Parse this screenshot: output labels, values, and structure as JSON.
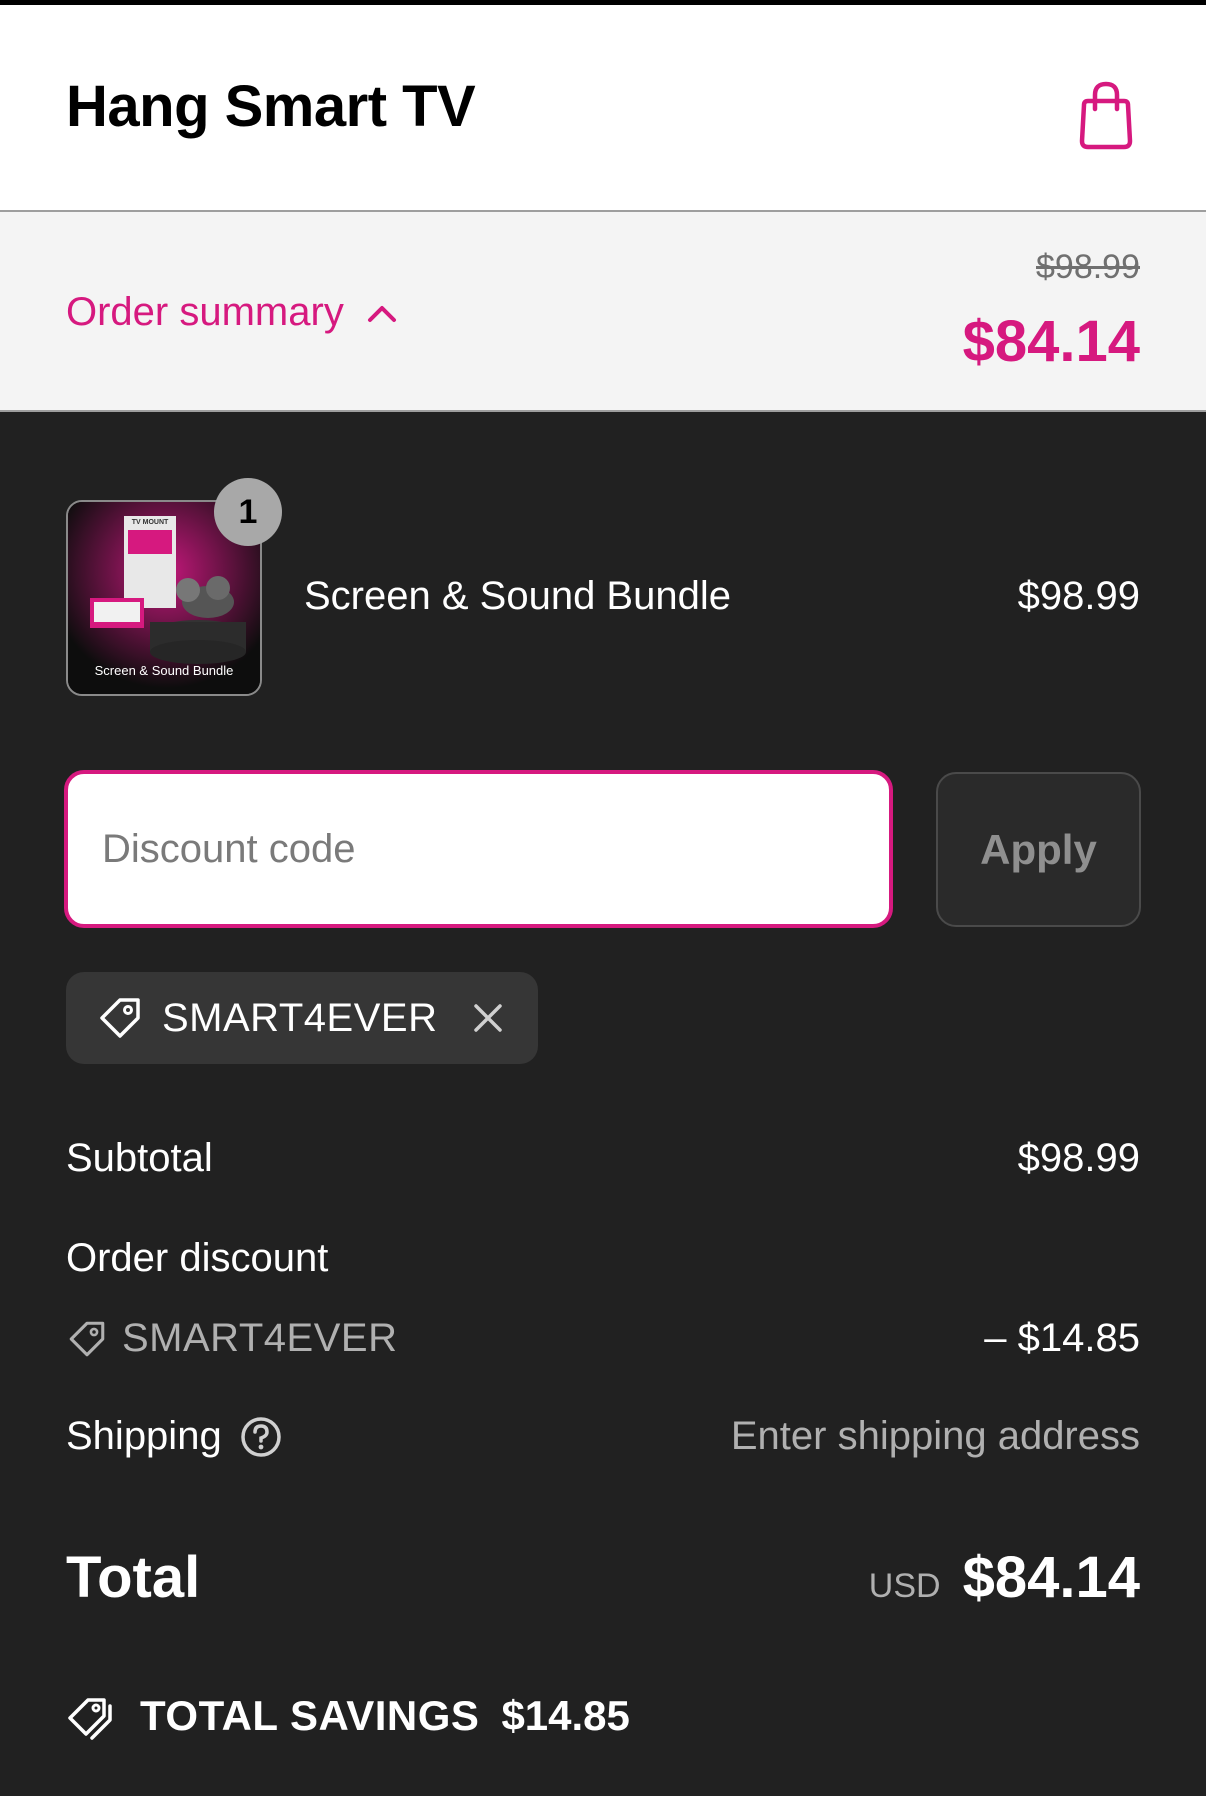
{
  "header": {
    "store_name": "Hang Smart TV",
    "cart_icon": "shopping-bag-icon"
  },
  "summary": {
    "toggle_label": "Order summary",
    "toggle_icon": "chevron-up-icon",
    "original_price": "$98.99",
    "current_price": "$84.14"
  },
  "item": {
    "name": "Screen & Sound Bundle",
    "price": "$98.99",
    "quantity": "1",
    "image_caption": "Screen & Sound Bundle",
    "image_small_text": "TV MOUNT"
  },
  "discount": {
    "placeholder": "Discount code",
    "apply_label": "Apply",
    "applied_code": "SMART4EVER"
  },
  "totals": {
    "subtotal_label": "Subtotal",
    "subtotal_value": "$98.99",
    "order_discount_label": "Order discount",
    "discount_code": "SMART4EVER",
    "discount_value": "– $14.85",
    "shipping_label": "Shipping",
    "shipping_value": "Enter shipping address",
    "total_label": "Total",
    "currency": "USD",
    "total_value": "$84.14",
    "savings_label": "TOTAL SAVINGS",
    "savings_value": "$14.85"
  },
  "colors": {
    "accent": "#d6197f",
    "dark_bg": "#212121",
    "summary_bg": "#f4f4f4"
  }
}
